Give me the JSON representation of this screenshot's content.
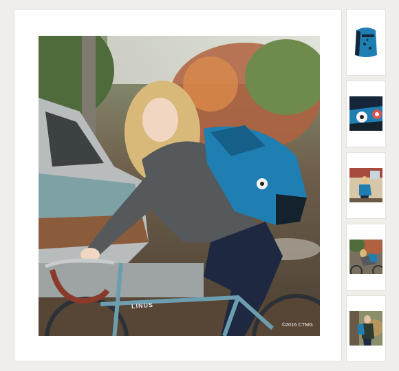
{
  "main_image": {
    "alt_subject": "girl-on-bicycle-with-backpack",
    "bike_brand": "LINUS",
    "copyright": "©2016 CTMG"
  },
  "thumbnails": [
    {
      "subject": "backpack-front"
    },
    {
      "subject": "backpack-detail-patch"
    },
    {
      "subject": "girl-with-backpack-street"
    },
    {
      "subject": "girl-on-bicycle"
    },
    {
      "subject": "boy-with-backpack"
    }
  ],
  "colors": {
    "page_bg": "#f0eeea",
    "card_bg": "#ffffff",
    "card_border": "#e4e1dc",
    "backpack_blue": "#1f7fb3"
  }
}
